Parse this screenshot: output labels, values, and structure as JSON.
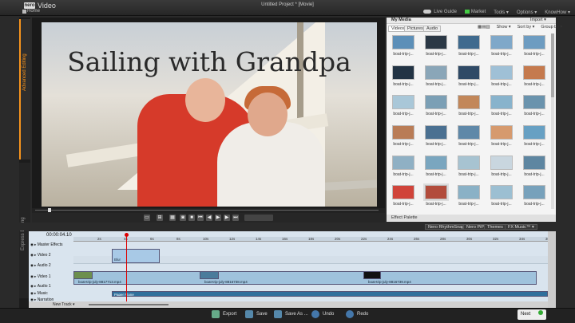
{
  "app": {
    "logo_text": "nero",
    "name": "Video",
    "home": "Home",
    "document_title": "Untitled Project * [Movie]"
  },
  "menu": {
    "live_guide": "Live Guide",
    "market": "Market",
    "tools": "Tools ▾",
    "options": "Options ▾",
    "knowhow": "KnowHow ▾"
  },
  "left_tabs": {
    "advanced": "Advanced Editing",
    "express": "Express Editing"
  },
  "preview": {
    "overlay_title": "Sailing with Grandpa"
  },
  "media": {
    "title": "My Media",
    "import": "Import ▾",
    "tabs": [
      "Videos",
      "Pictures",
      "Audio"
    ],
    "show": "Show ▾",
    "sort": "Sort by ▾",
    "group": "Group by ▾",
    "thumb_label": "boat-trip-j...",
    "thumb_colors": [
      "#5c8fb8",
      "#2b3845",
      "#3f6a8e",
      "#7fa8c9",
      "#6d9cc1",
      "#223344",
      "#8aa6b8",
      "#2f4a66",
      "#9fc0d6",
      "#c57a4e",
      "#a9c7d8",
      "#7b9fb5",
      "#c2875a",
      "#88b3cc",
      "#6a93ad",
      "#b97c56",
      "#4a7091",
      "#5f88a8",
      "#d69a6e",
      "#67a0c3",
      "#8fb0c4",
      "#7aa6bf",
      "#a7c3d1",
      "#c9d6df",
      "#5e86a1",
      "#d0443a",
      "#b24c3c",
      "#8ab1c6",
      "#9cbfd2",
      "#77a1bb"
    ],
    "effect_palette": "Effect Palette"
  },
  "timeline_toolbar": {
    "rhythm": "Nero RhythmSnap™",
    "pip": "Nero PiP",
    "themes": "Themes",
    "fx_music": "FX Music™ ▾"
  },
  "timeline": {
    "timecode": "00:00:04.10",
    "ruler": [
      "2s",
      "4s",
      "6s",
      "8s",
      "10s",
      "12s",
      "14s",
      "16s",
      "18s",
      "20s",
      "22s",
      "24s",
      "26s",
      "28s",
      "30s",
      "32s",
      "34s",
      "36s"
    ],
    "tracks": [
      "Master Effects",
      "Video 2",
      "Audio 2",
      "Video 1",
      "Audio 1",
      "Music",
      "Narration"
    ],
    "clip_blur": "Blur",
    "clips_video1": [
      "boat-trip-july-8817713.mp4",
      "boat-trip-july-8816738.mp4",
      "boat-trip-july-8816739.mp4"
    ],
    "clip_music": "Paper Plane",
    "new_track": "New Track ▾"
  },
  "bottom": {
    "export": "Export",
    "save": "Save",
    "save_as": "Save As ...",
    "undo": "Undo",
    "redo": "Redo",
    "next": "Next"
  },
  "colors": {
    "accent_orange": "#f7941d",
    "playhead": "#dd0000"
  }
}
